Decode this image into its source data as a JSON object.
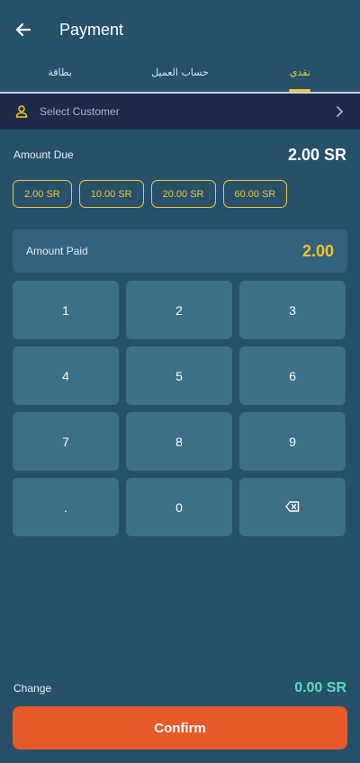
{
  "header": {
    "title": "Payment"
  },
  "tabs": [
    {
      "label": "بطاقة",
      "active": false
    },
    {
      "label": "حساب العميل",
      "active": false
    },
    {
      "label": "نقدي",
      "active": true
    }
  ],
  "customer": {
    "placeholder": "Select Customer"
  },
  "amount_due": {
    "label": "Amount Due",
    "value": "2.00 SR"
  },
  "quick_amounts": [
    "2.00 SR",
    "10.00 SR",
    "20.00 SR",
    "60.00 SR"
  ],
  "amount_paid": {
    "label": "Amount Paid",
    "value": "2.00"
  },
  "keypad": [
    "1",
    "2",
    "3",
    "4",
    "5",
    "6",
    "7",
    "8",
    "9",
    ".",
    "0",
    "backspace"
  ],
  "change": {
    "label": "Change",
    "value": "0.00 SR"
  },
  "confirm_label": "Confirm",
  "colors": {
    "background": "#27516a",
    "accent": "#f4c430",
    "confirm": "#e8592a",
    "change": "#57e0b2",
    "customer_bar": "#1c2a48"
  },
  "icons": {
    "back": "arrow-left-icon",
    "customer": "person-icon",
    "chevron": "chevron-right-icon",
    "backspace": "backspace-icon"
  }
}
